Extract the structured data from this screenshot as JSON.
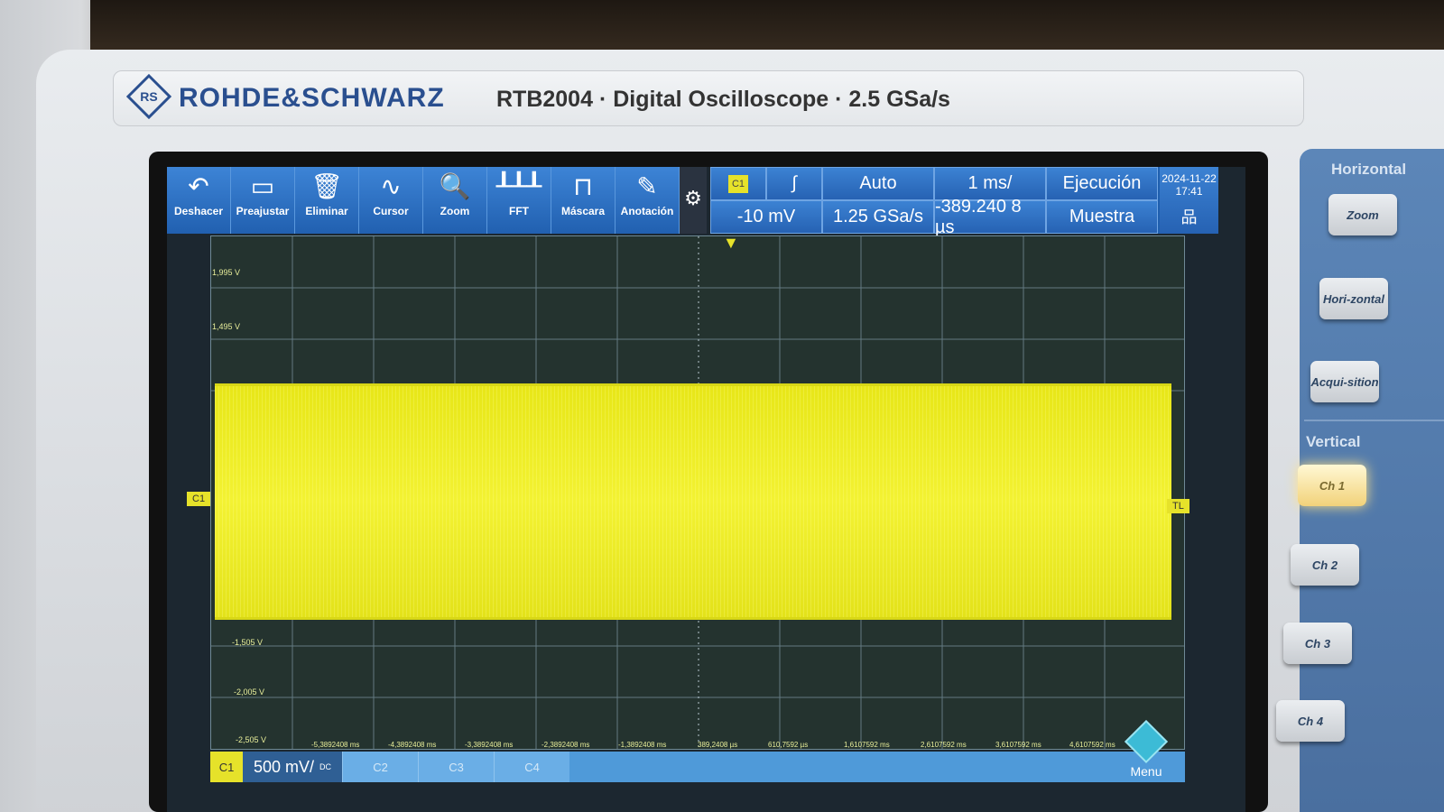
{
  "instrument": {
    "brand": "ROHDE&SCHWARZ",
    "model": "RTB2004 · Digital Oscilloscope · 2.5 GSa/s"
  },
  "toolbar": {
    "items": [
      {
        "label": "Deshacer",
        "icon": "undo-icon"
      },
      {
        "label": "Preajustar",
        "icon": "preset-icon"
      },
      {
        "label": "Eliminar",
        "icon": "trash-icon"
      },
      {
        "label": "Cursor",
        "icon": "cursor-icon"
      },
      {
        "label": "Zoom",
        "icon": "zoom-icon"
      },
      {
        "label": "FFT",
        "icon": "fft-icon"
      },
      {
        "label": "Máscara",
        "icon": "mask-icon"
      },
      {
        "label": "Anotación",
        "icon": "pencil-icon"
      }
    ]
  },
  "trigger": {
    "source": "C1",
    "level": "-10 mV",
    "mode": "Auto",
    "sample_rate": "1.25 GSa/s",
    "timebase": "1 ms/",
    "position": "-389.240 8 µs",
    "run_state": "Ejecución",
    "acq_mode": "Muestra"
  },
  "status": {
    "date": "2024-11-22",
    "time": "17:41"
  },
  "graticule": {
    "v_labels": [
      "1,995 V",
      "1,495 V",
      "-1,505 V",
      "-2,005 V",
      "-2,505 V"
    ],
    "t_labels": [
      "-5,3892408 ms",
      "-4,3892408 ms",
      "-3,3892408 ms",
      "-2,3892408 ms",
      "-1,3892408 ms",
      "389,2408 µs",
      "610,7592 µs",
      "1,6107592 ms",
      "2,6107592 ms",
      "3,6107592 ms",
      "4,6107592 ms"
    ],
    "ch_marker": "C1",
    "trig_marker": "TL",
    "trace_color": "#e6e22a"
  },
  "bottom": {
    "c1": "C1",
    "c1_scale": "500 mV/",
    "coupling": "DC",
    "c2": "C2",
    "c3": "C3",
    "c4": "C4",
    "menu": "Menu"
  },
  "panel": {
    "horizontal_title": "Horizontal",
    "zoom": "Zoom",
    "horizontal": "Hori-zontal",
    "acquisition": "Acqui-sition",
    "vertical_title": "Vertical",
    "ch1": "Ch 1",
    "ch2": "Ch 2",
    "ch3": "Ch 3",
    "ch4": "Ch 4"
  }
}
